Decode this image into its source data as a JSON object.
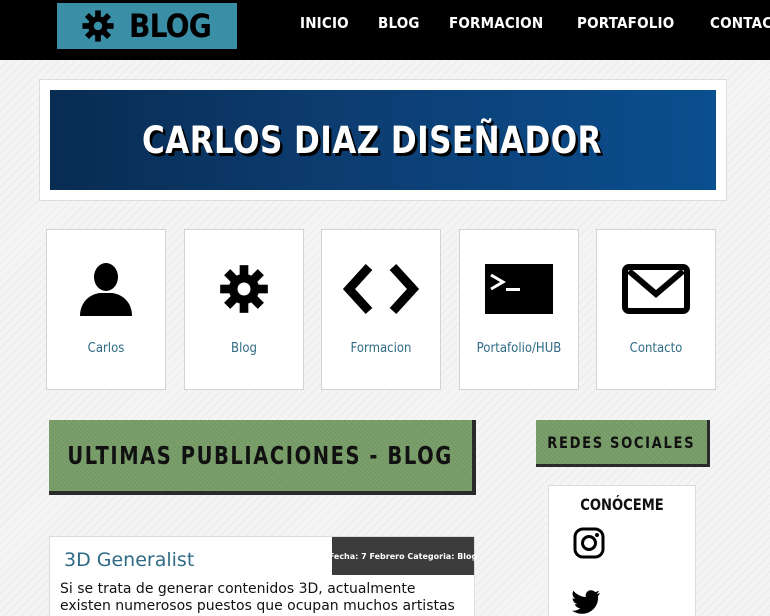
{
  "brand": {
    "logo_text": "BLOG",
    "icon": "gear-icon"
  },
  "nav": {
    "items": [
      {
        "label": "INICIO"
      },
      {
        "label": "BLOG"
      },
      {
        "label": "FORMACION"
      },
      {
        "label": "PORTAFOLIO"
      },
      {
        "label": "CONTACTO"
      }
    ]
  },
  "banner": {
    "title": "CARLOS DIAZ DISEÑADOR"
  },
  "cards": [
    {
      "label": "Carlos",
      "icon": "user-icon"
    },
    {
      "label": "Blog",
      "icon": "gear-icon"
    },
    {
      "label": "Formacion",
      "icon": "code-icon"
    },
    {
      "label": "Portafolio/HUB",
      "icon": "terminal-icon"
    },
    {
      "label": "Contacto",
      "icon": "envelope-icon"
    }
  ],
  "section": {
    "title": "ULTIMAS PUBLIACIONES - BLOG"
  },
  "sidebar": {
    "redes_title": "REDES SOCIALES",
    "conoceme_title": "CONÓCEME",
    "social": [
      {
        "icon": "instagram-icon"
      },
      {
        "icon": "twitter-icon"
      }
    ]
  },
  "post": {
    "title": "3D Generalist",
    "meta": "Fecha: 7 Febrero Categoria: Blog",
    "excerpt": "Si se trata de generar contenidos 3D, actualmente existen numerosos puestos que ocupan muchos artistas y expertos"
  },
  "colors": {
    "nav_bg": "#000000",
    "logo_bg": "#3a8fa6",
    "banner_bg": "#0d3d72",
    "section_green": "#7ba06b",
    "link_teal": "#2f6b86",
    "meta_bg": "#3c3c3c"
  }
}
